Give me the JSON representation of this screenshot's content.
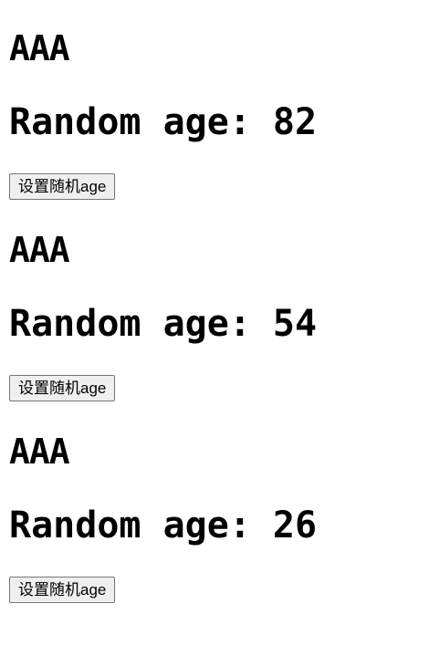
{
  "persons": [
    {
      "name": "AAA",
      "age_label": "Random age:",
      "age": "82",
      "button_label": "设置随机age"
    },
    {
      "name": "AAA",
      "age_label": "Random age:",
      "age": "54",
      "button_label": "设置随机age"
    },
    {
      "name": "AAA",
      "age_label": "Random age:",
      "age": "26",
      "button_label": "设置随机age"
    }
  ]
}
